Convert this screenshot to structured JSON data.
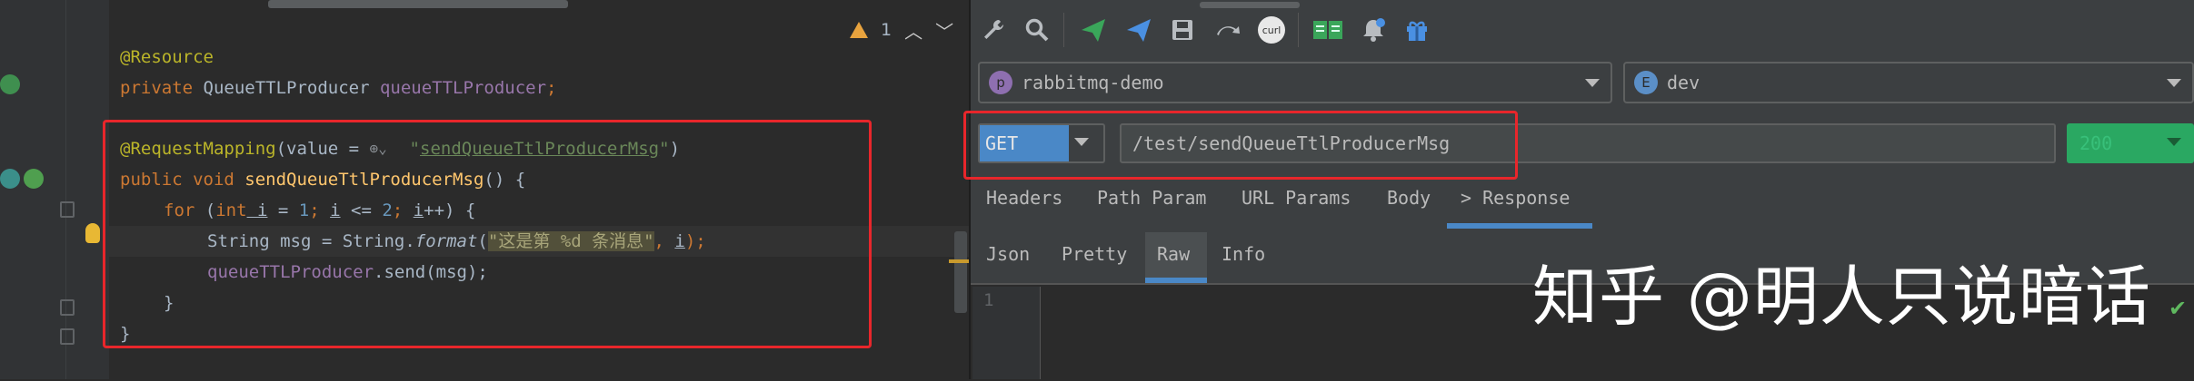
{
  "editor": {
    "warning_count": "1",
    "lines": {
      "l1": {
        "ann": "@Resource"
      },
      "l2": {
        "kw": "private",
        "type": " QueueTTLProducer ",
        "field": "queueTTLProducer",
        "end": ";"
      },
      "l3": {
        "ann": "@RequestMapping",
        "a": "(value = ",
        "b": "\"",
        "str": "sendQueueTtlProducerMsg",
        "c": "\"",
        "d": ")"
      },
      "l4": {
        "kw": "public void ",
        "fn": "sendQueueTtlProducerMsg",
        "rest": "() {"
      },
      "l5": {
        "kw1": "for",
        "a": " (",
        "kw2": "int",
        "v1": " i",
        "b": " = ",
        "n1": "1",
        "c": "; ",
        "v2": "i",
        "d": " <= ",
        "n2": "2",
        "e": "; ",
        "v3": "i",
        "f": "++) {"
      },
      "l6": {
        "a": "String msg = String.",
        "fmt": "format",
        "b": "(",
        "str": "\"这是第 %d 条消息\"",
        "c": ", ",
        "v": "i",
        "d": ");"
      },
      "l7": {
        "field": "queueTTLProducer",
        "rest": ".send(msg);"
      },
      "l8": {
        "text": "}"
      },
      "l9": {
        "text": "}"
      }
    }
  },
  "toolbar": {
    "icons": [
      "wrench-icon",
      "search-icon",
      "send-green-icon",
      "send-blue-icon",
      "save-icon",
      "redo-icon",
      "curl-icon",
      "book-icon",
      "bell-icon",
      "gift-icon"
    ],
    "curl_label": "curl"
  },
  "project_select": {
    "badge": "p",
    "value": "rabbitmq-demo"
  },
  "env_select": {
    "badge": "E",
    "value": "dev"
  },
  "request": {
    "method": "GET",
    "url": "/test/sendQueueTtlProducerMsg",
    "status": "200"
  },
  "tabs": [
    "Headers",
    "Path Param",
    "URL Params",
    "Body",
    "> Response"
  ],
  "sub_tabs": [
    "Json",
    "Pretty",
    "Raw",
    "Info"
  ],
  "response": {
    "line_number": "1"
  },
  "watermark": "知乎 @明人只说暗话",
  "colors": {
    "accent": "#4a88c7",
    "highlight_box": "#e8262b",
    "status_ok": "#2aa862"
  }
}
